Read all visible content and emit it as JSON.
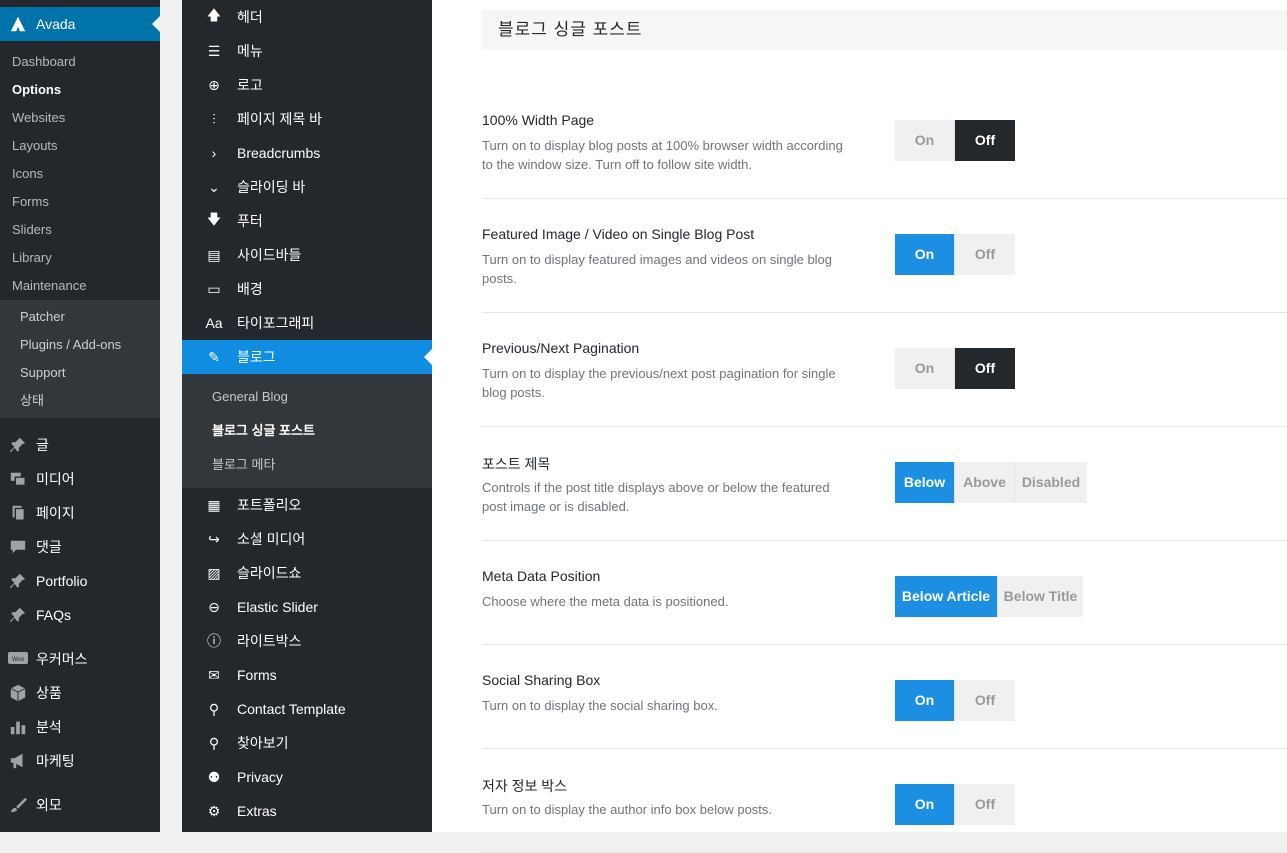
{
  "wp_menu": {
    "brand": "Avada",
    "sub_items": [
      {
        "label": "Dashboard",
        "current": false
      },
      {
        "label": "Options",
        "current": true
      },
      {
        "label": "Websites",
        "current": false
      },
      {
        "label": "Layouts",
        "current": false
      },
      {
        "label": "Icons",
        "current": false
      },
      {
        "label": "Forms",
        "current": false
      },
      {
        "label": "Sliders",
        "current": false
      },
      {
        "label": "Library",
        "current": false
      },
      {
        "label": "Maintenance",
        "current": false
      }
    ],
    "maintenance_items": [
      "Patcher",
      "Plugins / Add-ons",
      "Support",
      "상태"
    ],
    "items": [
      {
        "label": "글",
        "icon": "pin-icon"
      },
      {
        "label": "미디어",
        "icon": "media-icon"
      },
      {
        "label": "페이지",
        "icon": "page-icon"
      },
      {
        "label": "댓글",
        "icon": "comment-icon"
      },
      {
        "label": "Portfolio",
        "icon": "pin-icon"
      },
      {
        "label": "FAQs",
        "icon": "pin-icon"
      },
      {
        "label": "우커머스",
        "icon": "woo-icon"
      },
      {
        "label": "상품",
        "icon": "box-icon"
      },
      {
        "label": "분석",
        "icon": "chart-icon"
      },
      {
        "label": "마케팅",
        "icon": "megaphone-icon"
      },
      {
        "label": "외모",
        "icon": "brush-icon"
      }
    ]
  },
  "fusion_menu": {
    "items_top": [
      {
        "label": "헤더",
        "icon": "arrow-up-icon",
        "glyph": "🡅"
      },
      {
        "label": "메뉴",
        "icon": "menu-icon",
        "glyph": "☰"
      },
      {
        "label": "로고",
        "icon": "plus-circle-icon",
        "glyph": "⊕"
      },
      {
        "label": "페이지 제목 바",
        "icon": "sliders-icon",
        "glyph": "⫶"
      },
      {
        "label": "Breadcrumbs",
        "icon": "chevron-right-icon",
        "glyph": "›"
      },
      {
        "label": "슬라이딩 바",
        "icon": "chevron-down-icon",
        "glyph": "⌄"
      },
      {
        "label": "푸터",
        "icon": "arrow-down-icon",
        "glyph": "🡇"
      },
      {
        "label": "사이드바들",
        "icon": "sidebar-icon",
        "glyph": "▤"
      },
      {
        "label": "배경",
        "icon": "monitor-icon",
        "glyph": "▭"
      },
      {
        "label": "타이포그래피",
        "icon": "typography-icon",
        "glyph": "Aa"
      }
    ],
    "active": {
      "label": "블로그",
      "icon": "edit-icon",
      "glyph": "✎"
    },
    "sub_items": [
      {
        "label": "General Blog",
        "current": false
      },
      {
        "label": "블로그 싱글 포스트",
        "current": true
      },
      {
        "label": "블로그 메타",
        "current": false
      }
    ],
    "items_bottom": [
      {
        "label": "포트폴리오",
        "icon": "grid-icon",
        "glyph": "▦"
      },
      {
        "label": "소셜 미디어",
        "icon": "share-icon",
        "glyph": "↪"
      },
      {
        "label": "슬라이드쇼",
        "icon": "image-icon",
        "glyph": "▨"
      },
      {
        "label": "Elastic Slider",
        "icon": "circle-minus-icon",
        "glyph": "⊖"
      },
      {
        "label": "라이트박스",
        "icon": "info-icon",
        "glyph": "ⓘ"
      },
      {
        "label": "Forms",
        "icon": "envelope-icon",
        "glyph": "✉"
      },
      {
        "label": "Contact Template",
        "icon": "map-pin-icon",
        "glyph": "⚲"
      },
      {
        "label": "찾아보기",
        "icon": "search-icon",
        "glyph": "⚲"
      },
      {
        "label": "Privacy",
        "icon": "user-icon",
        "glyph": "⚉"
      },
      {
        "label": "Extras",
        "icon": "gears-icon",
        "glyph": "⚙"
      }
    ]
  },
  "main": {
    "section_title": "블로그 싱글 포스트",
    "options": [
      {
        "label": "100% Width Page",
        "desc": "Turn on to display blog posts at 100% browser width according to the window size. Turn off to follow site width.",
        "buttons": [
          "On",
          "Off"
        ],
        "selected": 1,
        "style": "dark"
      },
      {
        "label": "Featured Image / Video on Single Blog Post",
        "desc": "Turn on to display featured images and videos on single blog posts.",
        "buttons": [
          "On",
          "Off"
        ],
        "selected": 0,
        "style": "blue"
      },
      {
        "label": "Previous/Next Pagination",
        "desc": "Turn on to display the previous/next post pagination for single blog posts.",
        "buttons": [
          "On",
          "Off"
        ],
        "selected": 1,
        "style": "dark"
      },
      {
        "label": "포스트 제목",
        "desc": "Controls if the post title displays above or below the featured post image or is disabled.",
        "buttons": [
          "Below",
          "Above",
          "Disabled"
        ],
        "selected": 0,
        "style": "blue"
      },
      {
        "label": "Meta Data Position",
        "desc": "Choose where the meta data is positioned.",
        "buttons": [
          "Below Article",
          "Below Title"
        ],
        "selected": 0,
        "style": "blue"
      },
      {
        "label": "Social Sharing Box",
        "desc": "Turn on to display the social sharing box.",
        "buttons": [
          "On",
          "Off"
        ],
        "selected": 0,
        "style": "blue"
      },
      {
        "label": "저자 정보 박스",
        "desc": "Turn on to display the author info box below posts.",
        "buttons": [
          "On",
          "Off"
        ],
        "selected": 0,
        "style": "blue"
      }
    ]
  },
  "colors": {
    "wp_admin_bg": "#23282d",
    "wp_accent": "#0073aa",
    "fusion_active": "#0f8de0",
    "toggle_blue": "#1d8fe3",
    "toggle_dark": "#23282d"
  }
}
